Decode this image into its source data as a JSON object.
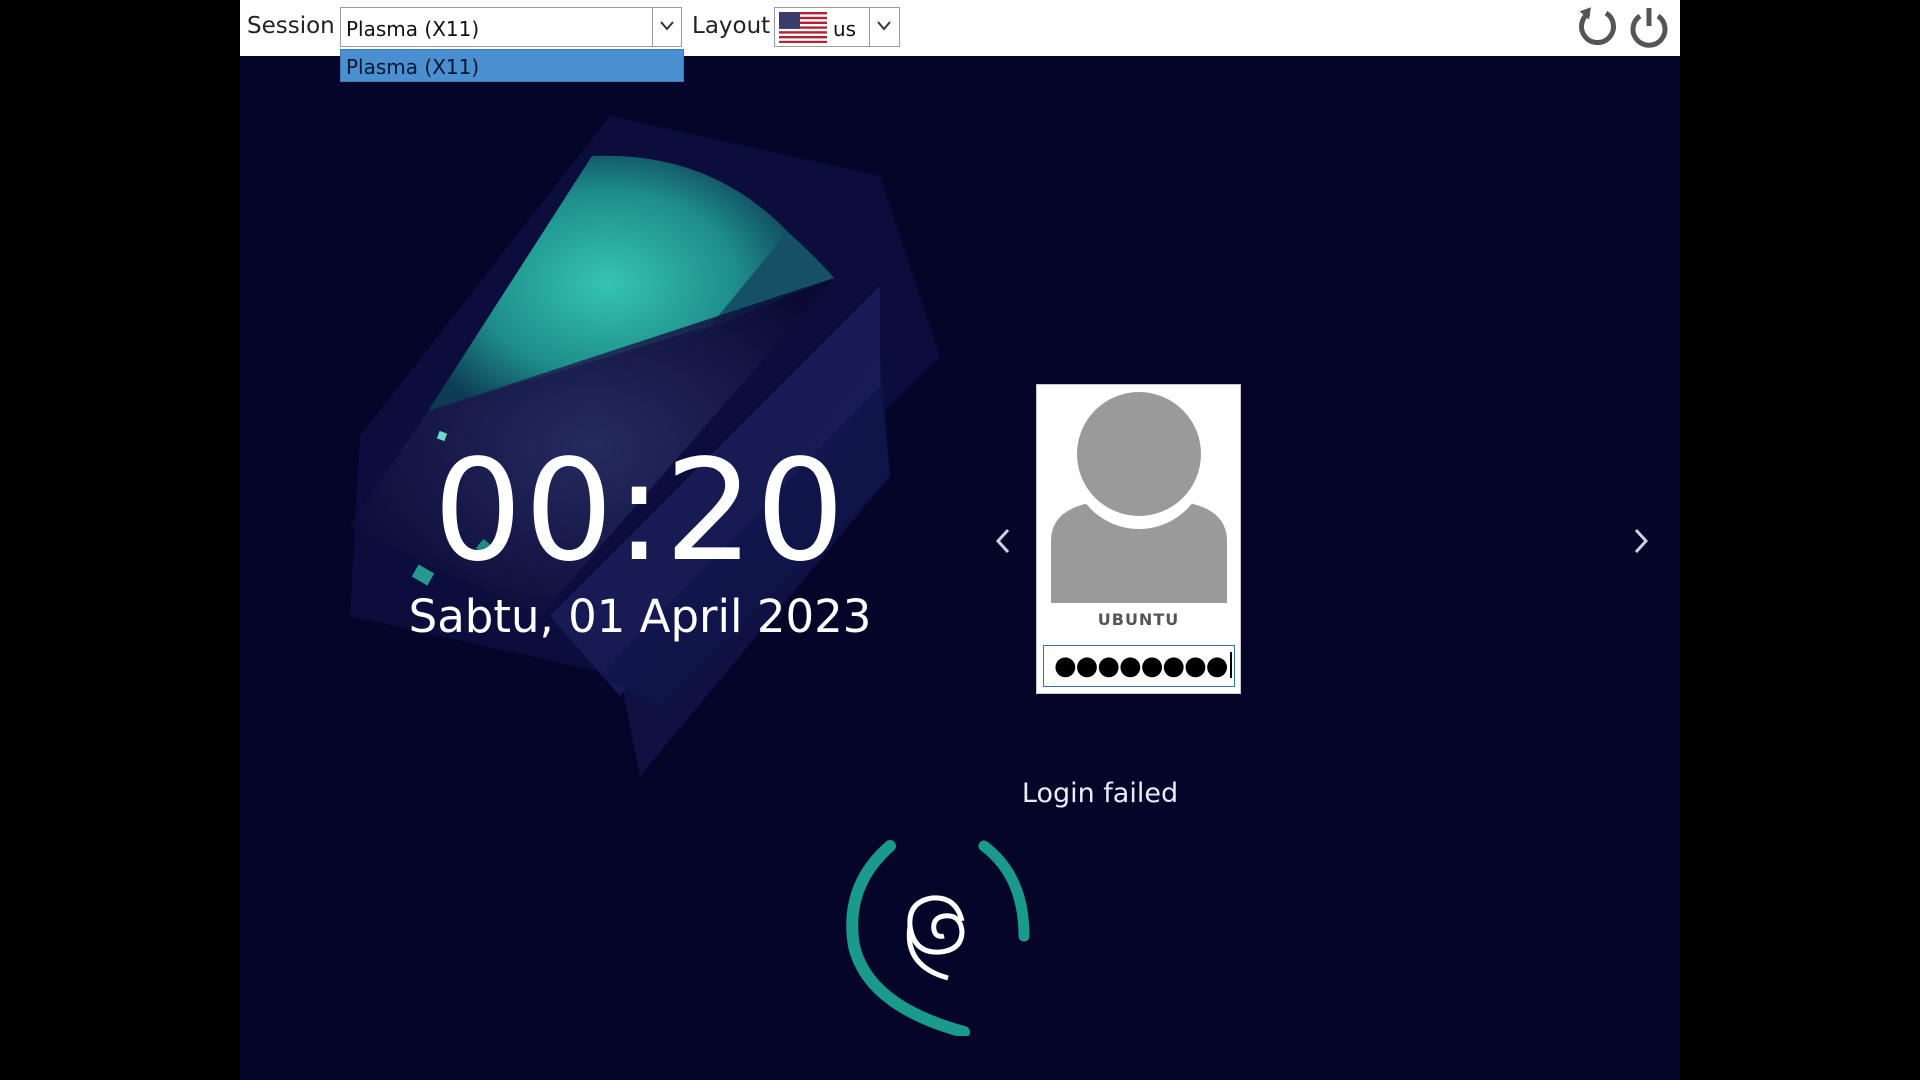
{
  "topbar": {
    "session_label": "Session",
    "session_value": "Plasma (X11)",
    "session_options": [
      "Plasma (X11)"
    ],
    "layout_label": "Layout",
    "layout_value": "us",
    "layout_flag_icon": "us-flag-icon",
    "reboot_icon": "reboot-icon",
    "shutdown_icon": "power-icon"
  },
  "clock": {
    "time": "00:20",
    "date": "Sabtu, 01 April 2023"
  },
  "user": {
    "name": "UBUNTU",
    "password_masked": "●●●●●●●●",
    "avatar_icon": "user-avatar-icon"
  },
  "status": {
    "message": "Login failed"
  },
  "colors": {
    "background": "#05052a",
    "accent_teal": "#2fb8a8",
    "selection_blue": "#4a90d0"
  }
}
